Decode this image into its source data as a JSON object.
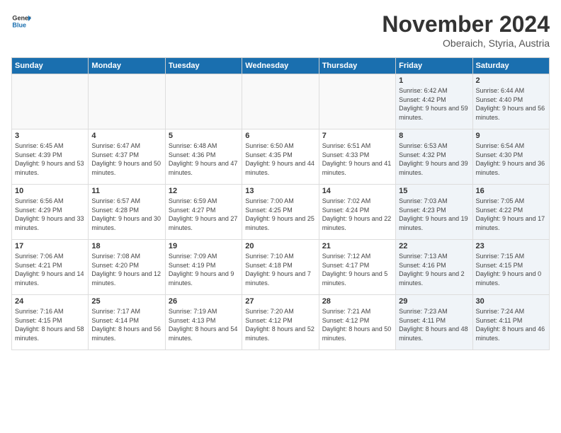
{
  "header": {
    "logo_line1": "General",
    "logo_line2": "Blue",
    "month": "November 2024",
    "location": "Oberaich, Styria, Austria"
  },
  "days_of_week": [
    "Sunday",
    "Monday",
    "Tuesday",
    "Wednesday",
    "Thursday",
    "Friday",
    "Saturday"
  ],
  "weeks": [
    [
      {
        "day": "",
        "info": "",
        "empty": true
      },
      {
        "day": "",
        "info": "",
        "empty": true
      },
      {
        "day": "",
        "info": "",
        "empty": true
      },
      {
        "day": "",
        "info": "",
        "empty": true
      },
      {
        "day": "",
        "info": "",
        "empty": true
      },
      {
        "day": "1",
        "info": "Sunrise: 6:42 AM\nSunset: 4:42 PM\nDaylight: 9 hours and 59 minutes.",
        "shaded": true
      },
      {
        "day": "2",
        "info": "Sunrise: 6:44 AM\nSunset: 4:40 PM\nDaylight: 9 hours and 56 minutes.",
        "shaded": true
      }
    ],
    [
      {
        "day": "3",
        "info": "Sunrise: 6:45 AM\nSunset: 4:39 PM\nDaylight: 9 hours and 53 minutes."
      },
      {
        "day": "4",
        "info": "Sunrise: 6:47 AM\nSunset: 4:37 PM\nDaylight: 9 hours and 50 minutes."
      },
      {
        "day": "5",
        "info": "Sunrise: 6:48 AM\nSunset: 4:36 PM\nDaylight: 9 hours and 47 minutes."
      },
      {
        "day": "6",
        "info": "Sunrise: 6:50 AM\nSunset: 4:35 PM\nDaylight: 9 hours and 44 minutes."
      },
      {
        "day": "7",
        "info": "Sunrise: 6:51 AM\nSunset: 4:33 PM\nDaylight: 9 hours and 41 minutes."
      },
      {
        "day": "8",
        "info": "Sunrise: 6:53 AM\nSunset: 4:32 PM\nDaylight: 9 hours and 39 minutes.",
        "shaded": true
      },
      {
        "day": "9",
        "info": "Sunrise: 6:54 AM\nSunset: 4:30 PM\nDaylight: 9 hours and 36 minutes.",
        "shaded": true
      }
    ],
    [
      {
        "day": "10",
        "info": "Sunrise: 6:56 AM\nSunset: 4:29 PM\nDaylight: 9 hours and 33 minutes."
      },
      {
        "day": "11",
        "info": "Sunrise: 6:57 AM\nSunset: 4:28 PM\nDaylight: 9 hours and 30 minutes."
      },
      {
        "day": "12",
        "info": "Sunrise: 6:59 AM\nSunset: 4:27 PM\nDaylight: 9 hours and 27 minutes."
      },
      {
        "day": "13",
        "info": "Sunrise: 7:00 AM\nSunset: 4:25 PM\nDaylight: 9 hours and 25 minutes."
      },
      {
        "day": "14",
        "info": "Sunrise: 7:02 AM\nSunset: 4:24 PM\nDaylight: 9 hours and 22 minutes."
      },
      {
        "day": "15",
        "info": "Sunrise: 7:03 AM\nSunset: 4:23 PM\nDaylight: 9 hours and 19 minutes.",
        "shaded": true
      },
      {
        "day": "16",
        "info": "Sunrise: 7:05 AM\nSunset: 4:22 PM\nDaylight: 9 hours and 17 minutes.",
        "shaded": true
      }
    ],
    [
      {
        "day": "17",
        "info": "Sunrise: 7:06 AM\nSunset: 4:21 PM\nDaylight: 9 hours and 14 minutes."
      },
      {
        "day": "18",
        "info": "Sunrise: 7:08 AM\nSunset: 4:20 PM\nDaylight: 9 hours and 12 minutes."
      },
      {
        "day": "19",
        "info": "Sunrise: 7:09 AM\nSunset: 4:19 PM\nDaylight: 9 hours and 9 minutes."
      },
      {
        "day": "20",
        "info": "Sunrise: 7:10 AM\nSunset: 4:18 PM\nDaylight: 9 hours and 7 minutes."
      },
      {
        "day": "21",
        "info": "Sunrise: 7:12 AM\nSunset: 4:17 PM\nDaylight: 9 hours and 5 minutes."
      },
      {
        "day": "22",
        "info": "Sunrise: 7:13 AM\nSunset: 4:16 PM\nDaylight: 9 hours and 2 minutes.",
        "shaded": true
      },
      {
        "day": "23",
        "info": "Sunrise: 7:15 AM\nSunset: 4:15 PM\nDaylight: 9 hours and 0 minutes.",
        "shaded": true
      }
    ],
    [
      {
        "day": "24",
        "info": "Sunrise: 7:16 AM\nSunset: 4:15 PM\nDaylight: 8 hours and 58 minutes."
      },
      {
        "day": "25",
        "info": "Sunrise: 7:17 AM\nSunset: 4:14 PM\nDaylight: 8 hours and 56 minutes."
      },
      {
        "day": "26",
        "info": "Sunrise: 7:19 AM\nSunset: 4:13 PM\nDaylight: 8 hours and 54 minutes."
      },
      {
        "day": "27",
        "info": "Sunrise: 7:20 AM\nSunset: 4:12 PM\nDaylight: 8 hours and 52 minutes."
      },
      {
        "day": "28",
        "info": "Sunrise: 7:21 AM\nSunset: 4:12 PM\nDaylight: 8 hours and 50 minutes."
      },
      {
        "day": "29",
        "info": "Sunrise: 7:23 AM\nSunset: 4:11 PM\nDaylight: 8 hours and 48 minutes.",
        "shaded": true
      },
      {
        "day": "30",
        "info": "Sunrise: 7:24 AM\nSunset: 4:11 PM\nDaylight: 8 hours and 46 minutes.",
        "shaded": true
      }
    ]
  ]
}
